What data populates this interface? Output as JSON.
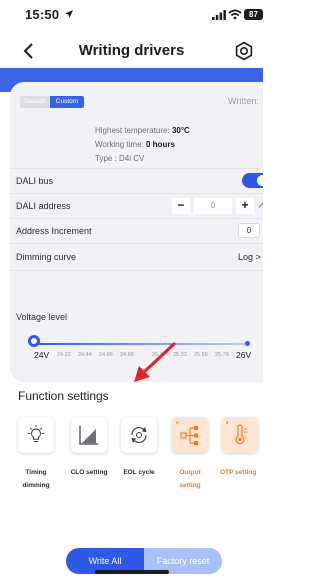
{
  "status_bar": {
    "time": "15:50",
    "battery": "87"
  },
  "nav": {
    "title": "Writing drivers"
  },
  "mode_toggle": {
    "default_label": "Default",
    "custom_label": "Custom",
    "selected": "Custom"
  },
  "written_label": "Written:",
  "info": {
    "highest_temperature_label": "Highest temperature:",
    "highest_temperature_value": "30°C",
    "working_time_label": "Working time:",
    "working_time_value": "0 hours",
    "type_label": "Type :",
    "type_value": "D4i CV"
  },
  "rows": {
    "dali_bus": {
      "label": "DALI bus",
      "enabled": true
    },
    "dali_address": {
      "label": "DALI address",
      "minus": "−",
      "value": "0",
      "plus": "+"
    },
    "address_increment": {
      "label": "Address Increment",
      "value": "0"
    },
    "dimming_curve": {
      "label": "Dimming curve",
      "value": "Log >"
    },
    "voltage_level": {
      "label": "Voltage level"
    }
  },
  "voltage_scale": {
    "min": "24V",
    "ticks": [
      "24.22",
      "24.44",
      "24.66",
      "24.88",
      "25.11",
      "25.33",
      "25.56",
      "25.78"
    ],
    "max": "26V",
    "current_fraction": 0
  },
  "function_settings": {
    "title": "Function settings",
    "items": [
      {
        "label_line1": "Timing",
        "label_line2": "dimming",
        "icon": "bulb-icon",
        "highlighted": false
      },
      {
        "label_line1": "CLO setting",
        "label_line2": "",
        "icon": "bar-graph-icon",
        "highlighted": false
      },
      {
        "label_line1": "EOL cycle",
        "label_line2": "",
        "icon": "cycle-icon",
        "highlighted": false
      },
      {
        "label_line1": "Output",
        "label_line2": "setting",
        "icon": "output-tree-icon",
        "highlighted": true
      },
      {
        "label_line1": "OTP setting",
        "label_line2": "",
        "icon": "thermometer-icon",
        "highlighted": true
      }
    ]
  },
  "actions": {
    "write_all": "Write All",
    "factory_reset": "Factory reset"
  },
  "colors": {
    "accent": "#2d59e6",
    "highlight": "#e87a25",
    "highlight_bg": "#fde4d0",
    "annotation_arrow": "#e0262a"
  }
}
